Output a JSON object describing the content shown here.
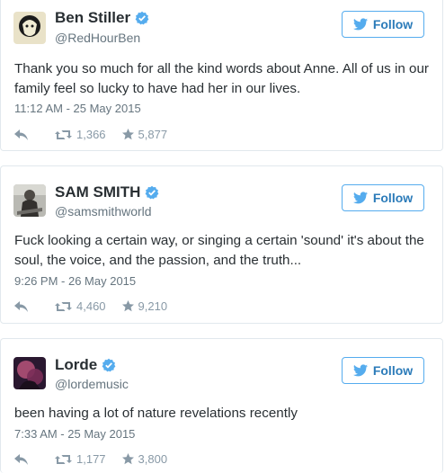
{
  "tweets": [
    {
      "name": "Ben Stiller",
      "handle": "@RedHourBen",
      "follow_label": "Follow",
      "text": "Thank you so much for all the kind words about Anne.  All of us in our family feel so lucky to have had her in our lives.",
      "timestamp": "11:12 AM - 25 May 2015",
      "retweets": "1,366",
      "favorites": "5,877"
    },
    {
      "name": "SAM SMITH",
      "handle": "@samsmithworld",
      "follow_label": "Follow",
      "text": "Fuck looking a certain way, or singing a certain 'sound' it's about the soul, the voice, and the passion, and the truth...",
      "timestamp": "9:26 PM - 26 May 2015",
      "retweets": "4,460",
      "favorites": "9,210"
    },
    {
      "name": "Lorde",
      "handle": "@lordemusic",
      "follow_label": "Follow",
      "text": "been having a lot of nature revelations recently",
      "timestamp": "7:33 AM - 25 May 2015",
      "retweets": "1,177",
      "favorites": "3,800"
    }
  ],
  "colors": {
    "accent": "#55acee",
    "follow_text": "#2b7bb9",
    "muted": "#66757f",
    "action": "#8899a6"
  },
  "icons": [
    "verified-badge-icon",
    "twitter-bird-icon",
    "reply-icon",
    "retweet-icon",
    "favorite-star-icon"
  ]
}
